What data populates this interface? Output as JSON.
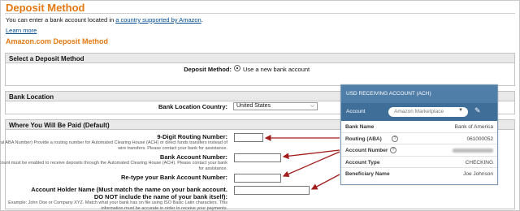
{
  "page": {
    "title": "Deposit Method",
    "intro_prefix": "You can enter a bank account located in ",
    "intro_link": "a country supported by Amazon",
    "intro_suffix": ".",
    "learn_more": "Learn more",
    "subtitle": "Amazon.com Deposit Method"
  },
  "select_method": {
    "heading": "Select a Deposit Method",
    "label": "Deposit Method:",
    "option": "Use a new bank account"
  },
  "bank_location": {
    "heading": "Bank Location",
    "label": "Bank Location Country:",
    "value": "United States"
  },
  "paid": {
    "heading": "Where You Will Be Paid (Default)",
    "routing_label": "9-Digit Routing Number:",
    "routing_help": "(Federal ABA Number) Provide a routing number for Automated Clearing House (ACH) or direct funds transfers instead of wire transfers. Please contact your bank for assistance.",
    "account_label": "Bank Account Number:",
    "account_help": "Your account must be enabled to receive deposits through the Automated Clearing House (ACH). Please contact your bank for assistance.",
    "retype_label": "Re-type your Bank Account Number:",
    "holder_label": "Account Holder Name (Must match the name on your bank account. DO NOT include the name of your bank itself):",
    "holder_help": "Example: John Doe or Company XYZ. Match what your bank has on file using ISO Basic Latin characters. This information must be accurate in order to receive your payments."
  },
  "card": {
    "header": "USD RECEIVING ACCOUNT (ACH)",
    "account_label": "Account",
    "account_value": "Amazon Marketplace",
    "rows": [
      {
        "label": "Bank Name",
        "value": "Bank of America"
      },
      {
        "label": "Routing (ABA)",
        "value": "061000052"
      },
      {
        "label": "Account Number",
        "value": ""
      },
      {
        "label": "Account Type",
        "value": "CHECKING"
      },
      {
        "label": "Beneficiary Name",
        "value": "Joe Johnson"
      }
    ]
  },
  "colors": {
    "brand_orange": "#e47911",
    "link_blue": "#004b91",
    "card_header": "#4f7ea8",
    "arrow_red": "#a31d1d"
  }
}
